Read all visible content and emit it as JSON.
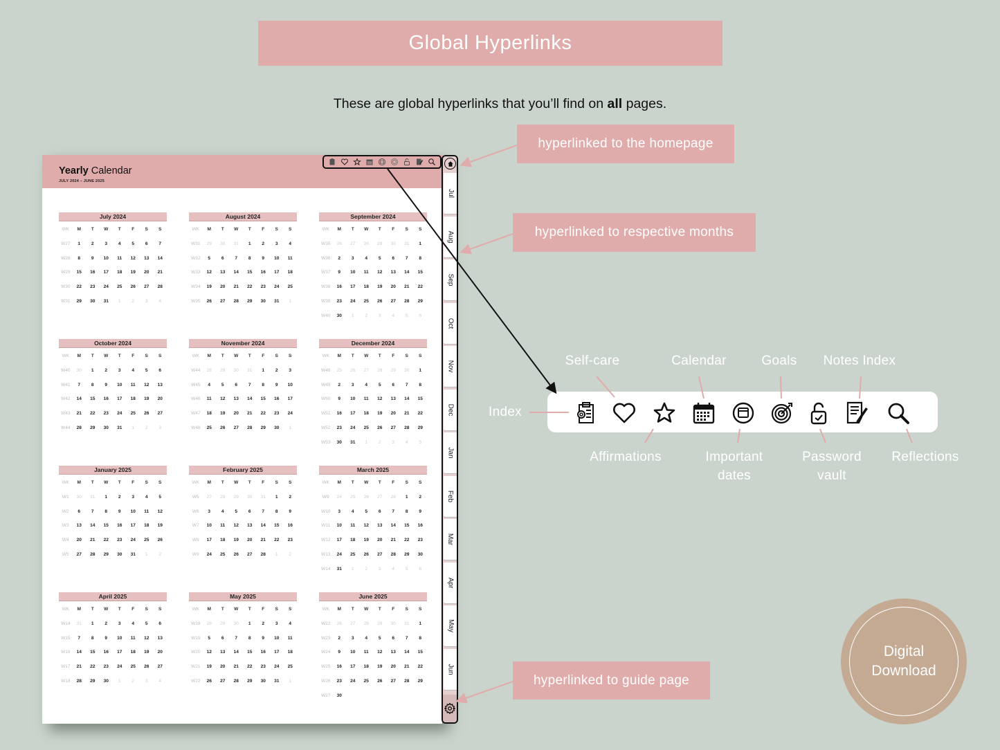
{
  "header": {
    "title": "Global Hyperlinks",
    "subtitle_pre": "These are global hyperlinks that you’ll find on ",
    "subtitle_bold": "all",
    "subtitle_post": " pages."
  },
  "page": {
    "title_bold": "Yearly",
    "title_rest": " Calendar",
    "range": "JULY 2024 – JUNE 2025",
    "weekday_headers": [
      "WK",
      "M",
      "T",
      "W",
      "T",
      "F",
      "S",
      "S"
    ],
    "months": [
      {
        "name": "July 2024",
        "weeks": [
          [
            "W27",
            "*1",
            "*2",
            "*3",
            "*4",
            "*5",
            "*6",
            "*7"
          ],
          [
            "W28",
            "*8",
            "*9",
            "*10",
            "*11",
            "*12",
            "*13",
            "*14"
          ],
          [
            "W29",
            "*15",
            "*16",
            "*17",
            "*18",
            "*19",
            "*20",
            "*21"
          ],
          [
            "W30",
            "*22",
            "*23",
            "*24",
            "*25",
            "*26",
            "*27",
            "*28"
          ],
          [
            "W31",
            "*29",
            "*30",
            "*31",
            "1",
            "2",
            "3",
            "4"
          ]
        ]
      },
      {
        "name": "August 2024",
        "weeks": [
          [
            "W31",
            "29",
            "30",
            "31",
            "*1",
            "*2",
            "*3",
            "*4"
          ],
          [
            "W32",
            "*5",
            "*6",
            "*7",
            "*8",
            "*9",
            "*10",
            "*11"
          ],
          [
            "W33",
            "*12",
            "*13",
            "*14",
            "*15",
            "*16",
            "*17",
            "*18"
          ],
          [
            "W34",
            "*19",
            "*20",
            "*21",
            "*22",
            "*23",
            "*24",
            "*25"
          ],
          [
            "W35",
            "*26",
            "*27",
            "*28",
            "*29",
            "*30",
            "*31",
            "1"
          ]
        ]
      },
      {
        "name": "September 2024",
        "weeks": [
          [
            "W35",
            "26",
            "27",
            "28",
            "29",
            "30",
            "31",
            "*1"
          ],
          [
            "W36",
            "*2",
            "*3",
            "*4",
            "*5",
            "*6",
            "*7",
            "*8"
          ],
          [
            "W37",
            "*9",
            "*10",
            "*11",
            "*12",
            "*13",
            "*14",
            "*15"
          ],
          [
            "W38",
            "*16",
            "*17",
            "*18",
            "*19",
            "*20",
            "*21",
            "*22"
          ],
          [
            "W39",
            "*23",
            "*24",
            "*25",
            "*26",
            "*27",
            "*28",
            "*29"
          ],
          [
            "W40",
            "*30",
            "1",
            "2",
            "3",
            "4",
            "5",
            "6"
          ]
        ]
      },
      {
        "name": "October 2024",
        "weeks": [
          [
            "W40",
            "30",
            "*1",
            "*2",
            "*3",
            "*4",
            "*5",
            "*6"
          ],
          [
            "W41",
            "*7",
            "*8",
            "*9",
            "*10",
            "*11",
            "*12",
            "*13"
          ],
          [
            "W42",
            "*14",
            "*15",
            "*16",
            "*17",
            "*18",
            "*19",
            "*20"
          ],
          [
            "W43",
            "*21",
            "*22",
            "*23",
            "*24",
            "*25",
            "*26",
            "*27"
          ],
          [
            "W44",
            "*28",
            "*29",
            "*30",
            "*31",
            "1",
            "2",
            "3"
          ]
        ]
      },
      {
        "name": "November 2024",
        "weeks": [
          [
            "W44",
            "28",
            "29",
            "30",
            "31",
            "*1",
            "*2",
            "*3"
          ],
          [
            "W45",
            "*4",
            "*5",
            "*6",
            "*7",
            "*8",
            "*9",
            "*10"
          ],
          [
            "W46",
            "*11",
            "*12",
            "*13",
            "*14",
            "*15",
            "*16",
            "*17"
          ],
          [
            "W47",
            "*18",
            "*19",
            "*20",
            "*21",
            "*22",
            "*23",
            "*24"
          ],
          [
            "W48",
            "*25",
            "*26",
            "*27",
            "*28",
            "*29",
            "*30",
            "1"
          ]
        ]
      },
      {
        "name": "December 2024",
        "weeks": [
          [
            "W48",
            "25",
            "26",
            "27",
            "28",
            "29",
            "30",
            "*1"
          ],
          [
            "W49",
            "*2",
            "*3",
            "*4",
            "*5",
            "*6",
            "*7",
            "*8"
          ],
          [
            "W50",
            "*9",
            "*10",
            "*11",
            "*12",
            "*13",
            "*14",
            "*15"
          ],
          [
            "W51",
            "*16",
            "*17",
            "*18",
            "*19",
            "*20",
            "*21",
            "*22"
          ],
          [
            "W52",
            "*23",
            "*24",
            "*25",
            "*26",
            "*27",
            "*28",
            "*29"
          ],
          [
            "W53",
            "*30",
            "*31",
            "1",
            "2",
            "3",
            "4",
            "5"
          ]
        ]
      },
      {
        "name": "January 2025",
        "weeks": [
          [
            "W1",
            "30",
            "31",
            "*1",
            "*2",
            "*3",
            "*4",
            "*5"
          ],
          [
            "W2",
            "*6",
            "*7",
            "*8",
            "*9",
            "*10",
            "*11",
            "*12"
          ],
          [
            "W3",
            "*13",
            "*14",
            "*15",
            "*16",
            "*17",
            "*18",
            "*19"
          ],
          [
            "W4",
            "*20",
            "*21",
            "*22",
            "*23",
            "*24",
            "*25",
            "*26"
          ],
          [
            "W5",
            "*27",
            "*28",
            "*29",
            "*30",
            "*31",
            "1",
            "2"
          ]
        ]
      },
      {
        "name": "February 2025",
        "weeks": [
          [
            "W5",
            "27",
            "28",
            "29",
            "30",
            "31",
            "*1",
            "*2"
          ],
          [
            "W6",
            "*3",
            "*4",
            "*5",
            "*6",
            "*7",
            "*8",
            "*9"
          ],
          [
            "W7",
            "*10",
            "*11",
            "*12",
            "*13",
            "*14",
            "*15",
            "*16"
          ],
          [
            "W8",
            "*17",
            "*18",
            "*19",
            "*20",
            "*21",
            "*22",
            "*23"
          ],
          [
            "W9",
            "*24",
            "*25",
            "*26",
            "*27",
            "*28",
            "1",
            "2"
          ]
        ]
      },
      {
        "name": "March 2025",
        "weeks": [
          [
            "W9",
            "24",
            "25",
            "26",
            "27",
            "28",
            "*1",
            "*2"
          ],
          [
            "W10",
            "*3",
            "*4",
            "*5",
            "*6",
            "*7",
            "*8",
            "*9"
          ],
          [
            "W11",
            "*10",
            "*11",
            "*12",
            "*13",
            "*14",
            "*15",
            "*16"
          ],
          [
            "W12",
            "*17",
            "*18",
            "*19",
            "*20",
            "*21",
            "*22",
            "*23"
          ],
          [
            "W13",
            "*24",
            "*25",
            "*26",
            "*27",
            "*28",
            "*29",
            "*30"
          ],
          [
            "W14",
            "*31",
            "1",
            "2",
            "3",
            "4",
            "5",
            "6"
          ]
        ]
      },
      {
        "name": "April 2025",
        "weeks": [
          [
            "W14",
            "31",
            "*1",
            "*2",
            "*3",
            "*4",
            "*5",
            "*6"
          ],
          [
            "W15",
            "*7",
            "*8",
            "*9",
            "*10",
            "*11",
            "*12",
            "*13"
          ],
          [
            "W16",
            "*14",
            "*15",
            "*16",
            "*17",
            "*18",
            "*19",
            "*20"
          ],
          [
            "W17",
            "*21",
            "*22",
            "*23",
            "*24",
            "*25",
            "*26",
            "*27"
          ],
          [
            "W18",
            "*28",
            "*29",
            "*30",
            "1",
            "2",
            "3",
            "4"
          ]
        ]
      },
      {
        "name": "May 2025",
        "weeks": [
          [
            "W18",
            "28",
            "29",
            "30",
            "*1",
            "*2",
            "*3",
            "*4"
          ],
          [
            "W19",
            "*5",
            "*6",
            "*7",
            "*8",
            "*9",
            "*10",
            "*11"
          ],
          [
            "W20",
            "*12",
            "*13",
            "*14",
            "*15",
            "*16",
            "*17",
            "*18"
          ],
          [
            "W21",
            "*19",
            "*20",
            "*21",
            "*22",
            "*23",
            "*24",
            "*25"
          ],
          [
            "W22",
            "*26",
            "*27",
            "*28",
            "*29",
            "*30",
            "*31",
            "1"
          ]
        ]
      },
      {
        "name": "June 2025",
        "weeks": [
          [
            "W22",
            "26",
            "27",
            "28",
            "29",
            "30",
            "31",
            "*1"
          ],
          [
            "W23",
            "*2",
            "*3",
            "*4",
            "*5",
            "*6",
            "*7",
            "*8"
          ],
          [
            "W24",
            "*9",
            "*10",
            "*11",
            "*12",
            "*13",
            "*14",
            "*15"
          ],
          [
            "W25",
            "*16",
            "*17",
            "*18",
            "*19",
            "*20",
            "*21",
            "*22"
          ],
          [
            "W26",
            "*23",
            "*24",
            "*25",
            "*26",
            "*27",
            "*28",
            "*29"
          ],
          [
            "W27",
            "*30",
            "",
            "",
            "",
            "",
            "",
            ""
          ]
        ]
      }
    ]
  },
  "side_tabs": [
    "Jul",
    "Aug",
    "Sep",
    "Oct",
    "Nov",
    "Dec",
    "Jan",
    "Feb",
    "Mar",
    "Apr",
    "May",
    "Jun"
  ],
  "callouts": {
    "home": "hyperlinked to the homepage",
    "months": "hyperlinked to respective months",
    "guide": "hyperlinked to guide page"
  },
  "icon_labels": {
    "index": "Index",
    "self_care": "Self-care",
    "affirmations": "Affirmations",
    "calendar": "Calendar",
    "important_dates_1": "Important",
    "important_dates_2": "dates",
    "goals": "Goals",
    "password_vault_1": "Password",
    "password_vault_2": "vault",
    "notes_index": "Notes Index",
    "reflections": "Reflections"
  },
  "badge": {
    "line1": "Digital",
    "line2": "Download"
  },
  "colors": {
    "background": "#cbd4cc",
    "accent_pink": "#e0abab",
    "badge": "#c4a993"
  }
}
